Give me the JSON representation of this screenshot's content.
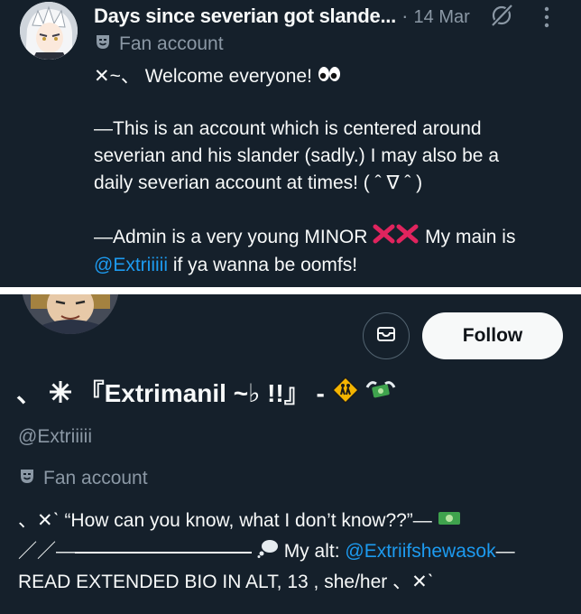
{
  "post": {
    "display_name": "Days since severian got slande...",
    "separator": "·",
    "date": "14 Mar",
    "badge_label": "Fan account",
    "welcome_prefix": "✕~、",
    "welcome_text": "Welcome everyone!",
    "para1_line1": "—This is an account which is centered around",
    "para1_line2": "severian and his slander (sadly.) I may also be a",
    "para1_line3": "daily severian account at times!  ( ˆ ∇ ˆ )",
    "para2_line1_a": "—Admin is a very young MINOR",
    "para2_line1_b": "My main is",
    "para2_mention": "@Extriiiii",
    "para2_line2_rest": " if ya wanna be oomfs!"
  },
  "profile": {
    "follow_label": "Follow",
    "name_prefix": "、",
    "name_main": "『Extrimanil ~♭ !!』 -",
    "handle": "@Extriiiii",
    "badge_label": "Fan account",
    "bio_line1_prefix": "、✕ˋ ",
    "bio_line1_text": "“How can you know, what I don’t know??”—",
    "bio_line2_prefix": "／／—",
    "bio_line2_alt": "My alt:",
    "bio_line2_mention": "@Extriifshewasok",
    "bio_line2_suffix": "—",
    "bio_line3": "READ EXTENDED BIO IN ALT, 13 , she/her 、✕ˋ"
  },
  "icons": {
    "badge": "theater-masks-icon",
    "grok": "grok-icon",
    "more": "more-vertical-icon",
    "eyes": "eyes-emoji",
    "cross": "cross-mark-emoji",
    "message": "envelope-icon",
    "sparkle": "sparkle-emoji",
    "children_crossing": "children-crossing-emoji",
    "money_wings": "money-with-wings-emoji",
    "dollar": "dollar-banknote-emoji",
    "thought": "thought-balloon-emoji"
  },
  "colors": {
    "background": "#15202b",
    "text": "#f7f9f9",
    "muted": "#8b98a5",
    "link": "#1d9bf0",
    "divider": "#ffffff",
    "cross_red": "#e0245e"
  }
}
